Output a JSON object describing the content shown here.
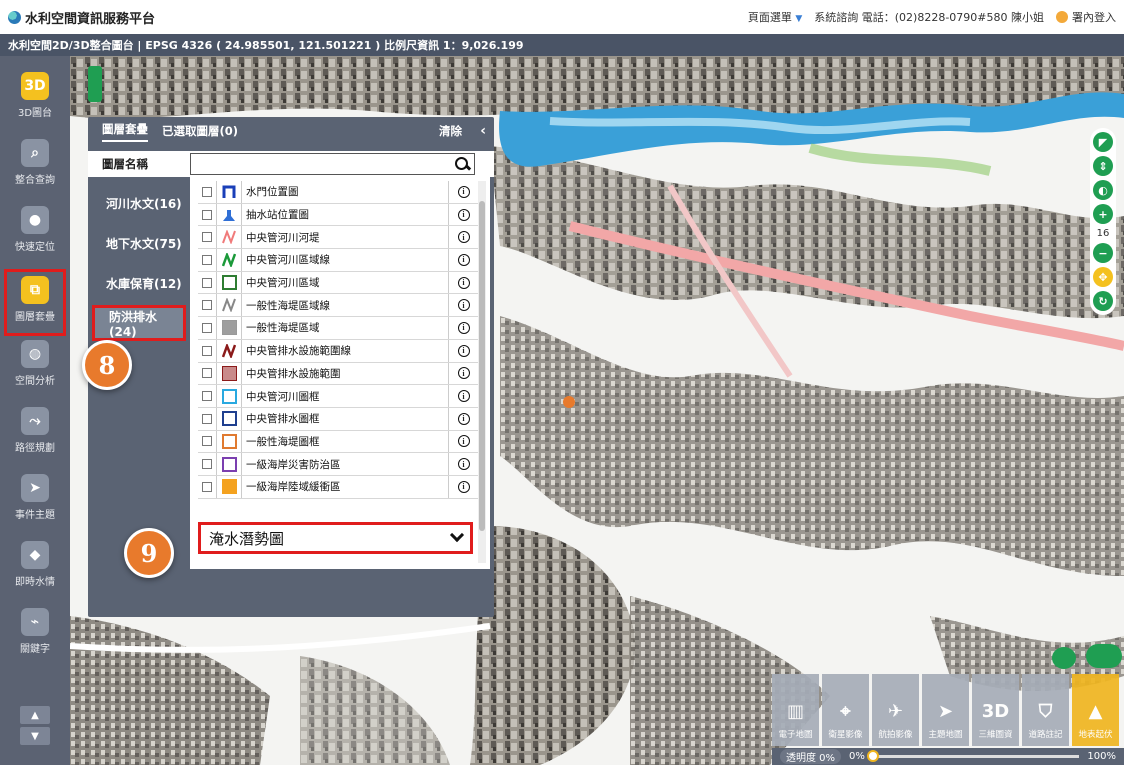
{
  "header": {
    "app_title": "水利空間資訊服務平台",
    "page_menu": "頁面選單",
    "consult": "系統諮詢 電話：(02)8228-0790#580 陳小姐",
    "login": "署內登入"
  },
  "coordbar": {
    "text": "水利空間2D/3D整合圖台 | EPSG 4326 ( 24.985501, 121.501221 ) 比例尺資訊 1：9,026.199"
  },
  "left_toolbar": {
    "items": [
      {
        "label": "3D圖台",
        "icon": "3D"
      },
      {
        "label": "整合查詢",
        "icon": "search-icon"
      },
      {
        "label": "快速定位",
        "icon": "pin-icon"
      },
      {
        "label": "圖層套疊",
        "icon": "layers-icon"
      },
      {
        "label": "空間分析",
        "icon": "globe-icon"
      },
      {
        "label": "路徑規劃",
        "icon": "route-icon"
      },
      {
        "label": "事件主題",
        "icon": "flag-icon"
      },
      {
        "label": "即時水情",
        "icon": "drop-icon"
      },
      {
        "label": "關鍵字",
        "icon": "tag-icon"
      }
    ]
  },
  "panel": {
    "tab_overlay": "圖層套疊",
    "tab_selected": "已選取圖層(0)",
    "clear": "清除",
    "collapse": "‹",
    "search_label": "圖層名稱",
    "search_value": "",
    "categories": [
      "河川水文(16)",
      "地下水文(75)",
      "水庫保育(12)",
      "防洪排水(24)"
    ],
    "layers": [
      {
        "name": "水門位置圖",
        "icon": "gate-icon",
        "color": "#1a3fb8"
      },
      {
        "name": "抽水站位置圖",
        "icon": "pump-icon",
        "color": "#2f6fd6"
      },
      {
        "name": "中央管河川河堤",
        "icon": "line-icon",
        "color": "#f07a7a"
      },
      {
        "name": "中央管河川區域線",
        "icon": "line-icon",
        "color": "#1b9a3a"
      },
      {
        "name": "中央管河川區域",
        "icon": "square-outline-icon",
        "color": "#2e7d32"
      },
      {
        "name": "一般性海堤區域線",
        "icon": "line-icon",
        "color": "#888888"
      },
      {
        "name": "一般性海堤區域",
        "icon": "square-fill-icon",
        "color": "#9e9e9e"
      },
      {
        "name": "中央管排水設施範圍線",
        "icon": "line-icon",
        "color": "#8b1a1a"
      },
      {
        "name": "中央管排水設施範圍",
        "icon": "square-fill-icon",
        "color": "#c98a8a"
      },
      {
        "name": "中央管河川圖框",
        "icon": "square-outline-icon",
        "color": "#29a9e0"
      },
      {
        "name": "中央管排水圖框",
        "icon": "square-outline-icon",
        "color": "#1f3f8f"
      },
      {
        "name": "一般性海堤圖框",
        "icon": "square-outline-icon",
        "color": "#e07a30"
      },
      {
        "name": "一級海岸災害防治區",
        "icon": "square-outline-icon",
        "color": "#7b3fb0"
      },
      {
        "name": "一級海岸陸域緩衝區",
        "icon": "square-fill-icon",
        "color": "#f4a21f"
      }
    ],
    "dropdown_value": "淹水潛勢圖"
  },
  "badges": {
    "step8": "8",
    "step9": "9"
  },
  "map_controls": {
    "zoom_level": "16"
  },
  "basemaps": {
    "items": [
      {
        "label": "電子地圖",
        "icon": "map-icon"
      },
      {
        "label": "衛星影像",
        "icon": "satellite-icon"
      },
      {
        "label": "航拍影像",
        "icon": "plane-icon"
      },
      {
        "label": "主題地圖",
        "icon": "paperplane-icon"
      },
      {
        "label": "三維圖資",
        "icon": "3D"
      },
      {
        "label": "道路註記",
        "icon": "road-icon"
      },
      {
        "label": "地表起伏",
        "icon": "terrain-icon"
      }
    ],
    "opacity_label": "透明度 0%",
    "opacity_min": "0%",
    "opacity_max": "100%",
    "opacity_value": 0
  },
  "colors": {
    "accent": "#f4c11f",
    "highlight": "#e01c1c",
    "panel": "#5a6373",
    "map_ctrl": "#1f9e52"
  }
}
